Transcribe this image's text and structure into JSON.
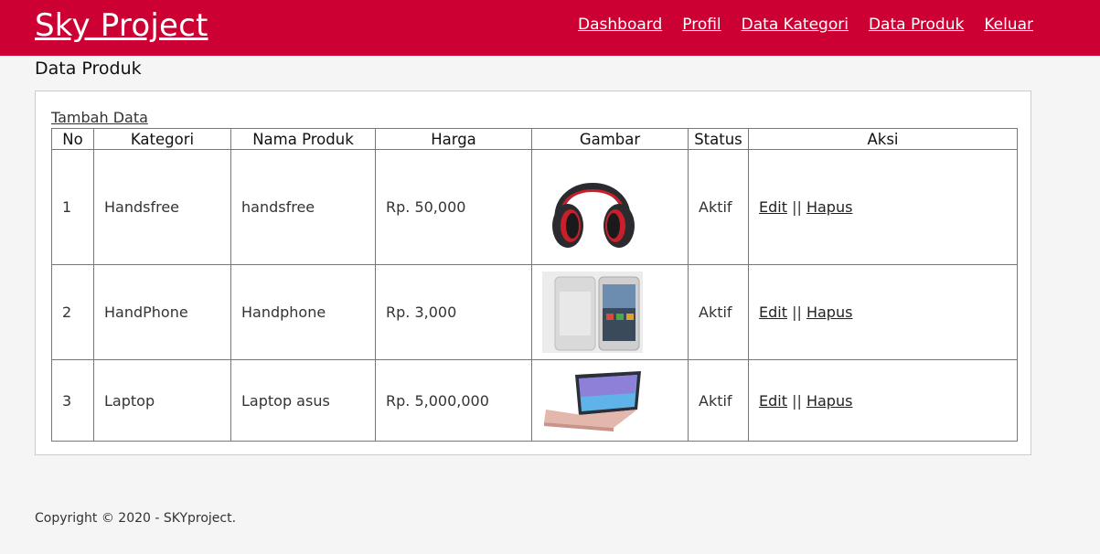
{
  "header": {
    "brand": "Sky Project",
    "nav": [
      "Dashboard",
      "Profil",
      "Data Kategori",
      "Data Produk",
      "Keluar"
    ]
  },
  "page_title": "Data Produk",
  "add_link": "Tambah Data",
  "table": {
    "columns": [
      "No",
      "Kategori",
      "Nama Produk",
      "Harga",
      "Gambar",
      "Status",
      "Aksi"
    ],
    "rows": [
      {
        "no": "1",
        "kategori": "Handsfree",
        "nama": "handsfree",
        "harga": "Rp. 50,000",
        "gambar": "headphones-image",
        "status": "Aktif",
        "edit": "Edit",
        "sep": "||",
        "hapus": "Hapus"
      },
      {
        "no": "2",
        "kategori": "HandPhone",
        "nama": "Handphone",
        "harga": "Rp. 3,000",
        "gambar": "smartphone-image",
        "status": "Aktif",
        "edit": "Edit",
        "sep": "||",
        "hapus": "Hapus"
      },
      {
        "no": "3",
        "kategori": "Laptop",
        "nama": "Laptop asus",
        "harga": "Rp. 5,000,000",
        "gambar": "laptop-image",
        "status": "Aktif",
        "edit": "Edit",
        "sep": "||",
        "hapus": "Hapus"
      }
    ]
  },
  "footer": "Copyright © 2020 - SKYproject.",
  "colors": {
    "header_bg": "#cc0033",
    "page_bg": "#f5f5f5"
  }
}
